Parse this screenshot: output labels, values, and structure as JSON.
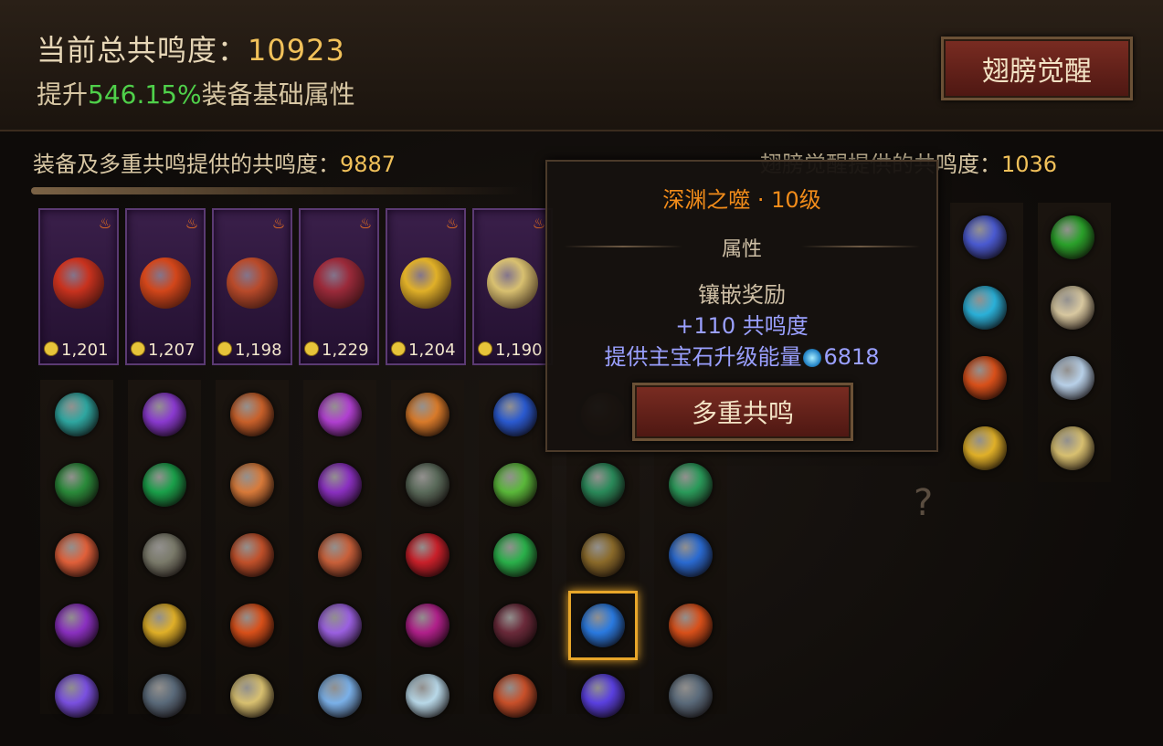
{
  "header": {
    "title_label": "当前总共鸣度：",
    "total_resonance": "10923",
    "sub_prefix": "提升",
    "sub_pct": "546.15%",
    "sub_suffix": "装备基础属性",
    "wing_button": "翅膀觉醒"
  },
  "sections": {
    "equip_label": "装备及多重共鸣提供的共鸣度：",
    "equip_value": "9887",
    "wing_label": "翅膀觉醒提供的共鸣度：",
    "wing_value": "1036"
  },
  "equipment": [
    {
      "value": "1,201",
      "color": "#c8321e"
    },
    {
      "value": "1,207",
      "color": "#d2461a"
    },
    {
      "value": "1,198",
      "color": "#b84a2a"
    },
    {
      "value": "1,229",
      "color": "#9a2a3a"
    },
    {
      "value": "1,204",
      "color": "#e0b028"
    },
    {
      "value": "1,190",
      "color": "#d8c070"
    }
  ],
  "gem_grid": [
    [
      "#2ea6a0",
      "#8a3ad0",
      "#c8602a",
      "#b040d0",
      "#d87a2a",
      "#2a5ad0",
      "#6a3a2a",
      "#5a7a3a"
    ],
    [
      "#2a8a3a",
      "#1aa04a",
      "#d87a3a",
      "#8a30c0",
      "#5a6a5a",
      "#5ab83a",
      "#2a8a5a",
      "#2a9a5a"
    ],
    [
      "#e0603a",
      "#7a7a6a",
      "#c0502a",
      "#c8603a",
      "#c8202a",
      "#2ab04a",
      "#8a6a2a",
      "#2a6ad0"
    ],
    [
      "#8a30c0",
      "#e0b028",
      "#d8501a",
      "#9a60e0",
      "#b0208a",
      "#6a2a3a",
      "#2a7ae0",
      "#d8501a"
    ],
    [
      "#7a50e0",
      "#5a6a7a",
      "#d8c070",
      "#7ab0e8",
      "#b8d8e8",
      "#c8502a",
      "#5a40e0",
      "#5a6a7a"
    ]
  ],
  "right_grid": [
    [
      "#4a5ad0",
      "#2aa02a"
    ],
    [
      "#2ab0d8",
      "#d8c8a0"
    ],
    [
      "#d8501a",
      "#b8d0e8"
    ],
    [
      "#e0b028",
      "#d8c070"
    ]
  ],
  "tooltip": {
    "title": "深渊之噬 · 10级",
    "attr_header": "属性",
    "bonus_header": "镶嵌奖励",
    "bonus_value": "+110 共鸣度",
    "energy_label": "提供主宝石升级能量",
    "energy_value": "6818",
    "multi_button": "多重共鸣"
  }
}
